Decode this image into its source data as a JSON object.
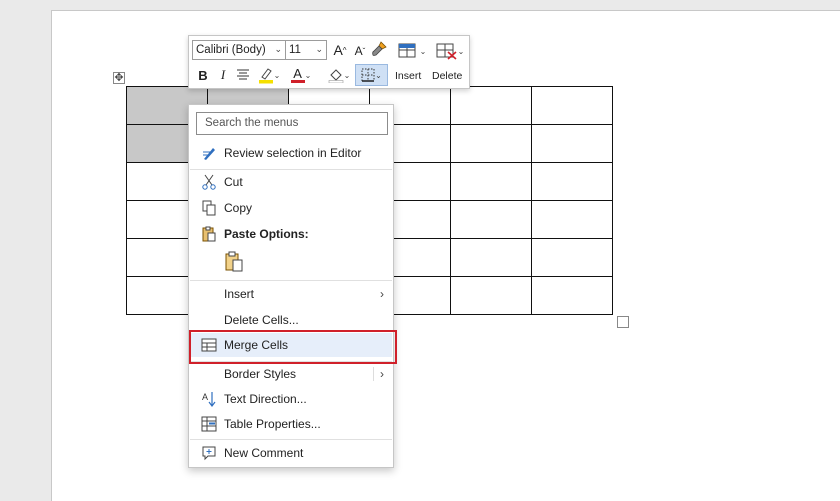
{
  "mini_toolbar": {
    "font_name": "Calibri (Body)",
    "font_size": "11",
    "grow_font": "A",
    "shrink_font": "A",
    "bold": "B",
    "italic": "I",
    "font_color_letter": "A",
    "highlight_color": "#f5e000",
    "font_color": "#d0202a",
    "insert_label": "Insert",
    "delete_label": "Delete"
  },
  "context_menu": {
    "search_placeholder": "Search the menus",
    "items": [
      {
        "label": "Review selection in Editor",
        "icon": "editor-pen-icon"
      },
      {
        "label": "Cut",
        "icon": "scissors-icon"
      },
      {
        "label": "Copy",
        "icon": "copy-icon"
      },
      {
        "label": "Paste Options:",
        "icon": "paste-icon"
      },
      {
        "label": "Insert",
        "icon": ""
      },
      {
        "label": "Delete Cells...",
        "icon": ""
      },
      {
        "label": "Merge Cells",
        "icon": "merge-cells-icon"
      },
      {
        "label": "Border Styles",
        "icon": ""
      },
      {
        "label": "Text Direction...",
        "icon": "text-direction-icon"
      },
      {
        "label": "Table Properties...",
        "icon": "table-properties-icon"
      },
      {
        "label": "New Comment",
        "icon": "comment-icon"
      }
    ],
    "highlight_color": "#d0202a"
  },
  "table": {
    "rows": 6,
    "cols": 6
  }
}
